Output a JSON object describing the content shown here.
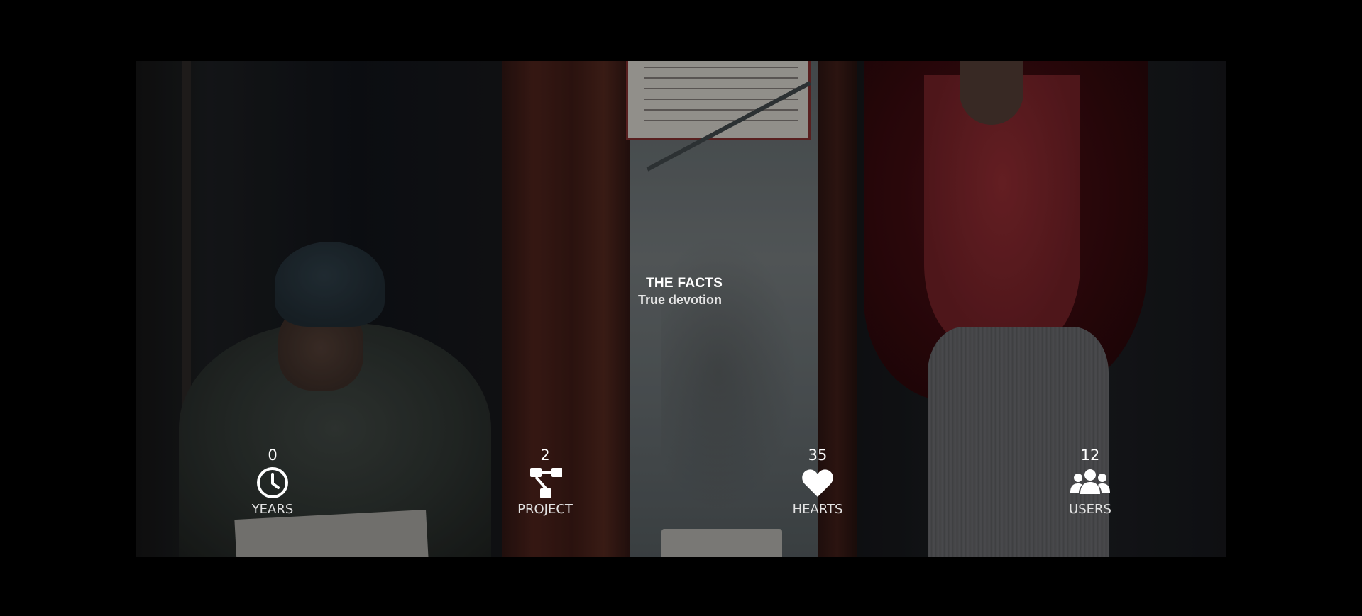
{
  "section": {
    "title": "THE FACTS",
    "subtitle": "True devotion"
  },
  "counters": [
    {
      "value": "0",
      "label": "YEARS",
      "icon": "clock-icon"
    },
    {
      "value": "2",
      "label": "PROJECT",
      "icon": "sitemap-icon"
    },
    {
      "value": "35",
      "label": "HEARTS",
      "icon": "heart-icon"
    },
    {
      "value": "12",
      "label": "USERS",
      "icon": "users-icon"
    }
  ],
  "colors": {
    "page_background": "#000000",
    "text": "#ffffff",
    "label": "#e3e3e3"
  }
}
